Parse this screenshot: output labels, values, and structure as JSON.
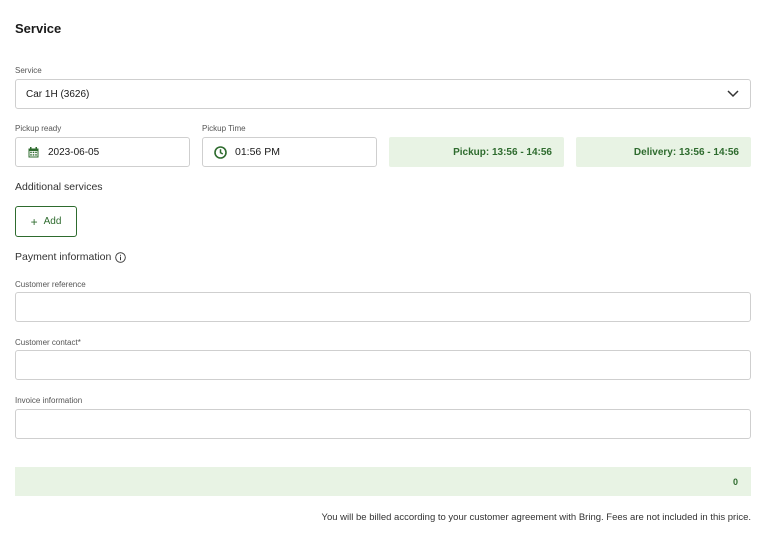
{
  "section": {
    "title": "Service"
  },
  "service": {
    "label": "Service",
    "selected": "Car 1H (3626)"
  },
  "pickup_ready": {
    "label": "Pickup ready",
    "value": "2023-06-05"
  },
  "pickup_time": {
    "label": "Pickup Time",
    "value": "01:56 PM"
  },
  "windows": {
    "pickup": "Pickup: 13:56 - 14:56",
    "delivery": "Delivery: 13:56 - 14:56"
  },
  "additional": {
    "label": "Additional services",
    "add_button": "Add"
  },
  "payment": {
    "label": "Payment information",
    "customer_reference": {
      "label": "Customer reference",
      "value": ""
    },
    "customer_contact": {
      "label": "Customer contact*",
      "value": ""
    },
    "invoice_information": {
      "label": "Invoice information",
      "value": ""
    }
  },
  "total": {
    "value": "0"
  },
  "footnote": "You will be billed according to your customer agreement with Bring. Fees are not included in this price.",
  "colors": {
    "accent": "#2e6b2e",
    "chip_background": "#e8f3e4",
    "border": "#cfcfcf"
  },
  "icons": {
    "calendar": "calendar-icon",
    "clock": "clock-icon",
    "chevron": "chevron-down-icon",
    "info": "info-icon",
    "plus": "plus-icon"
  }
}
